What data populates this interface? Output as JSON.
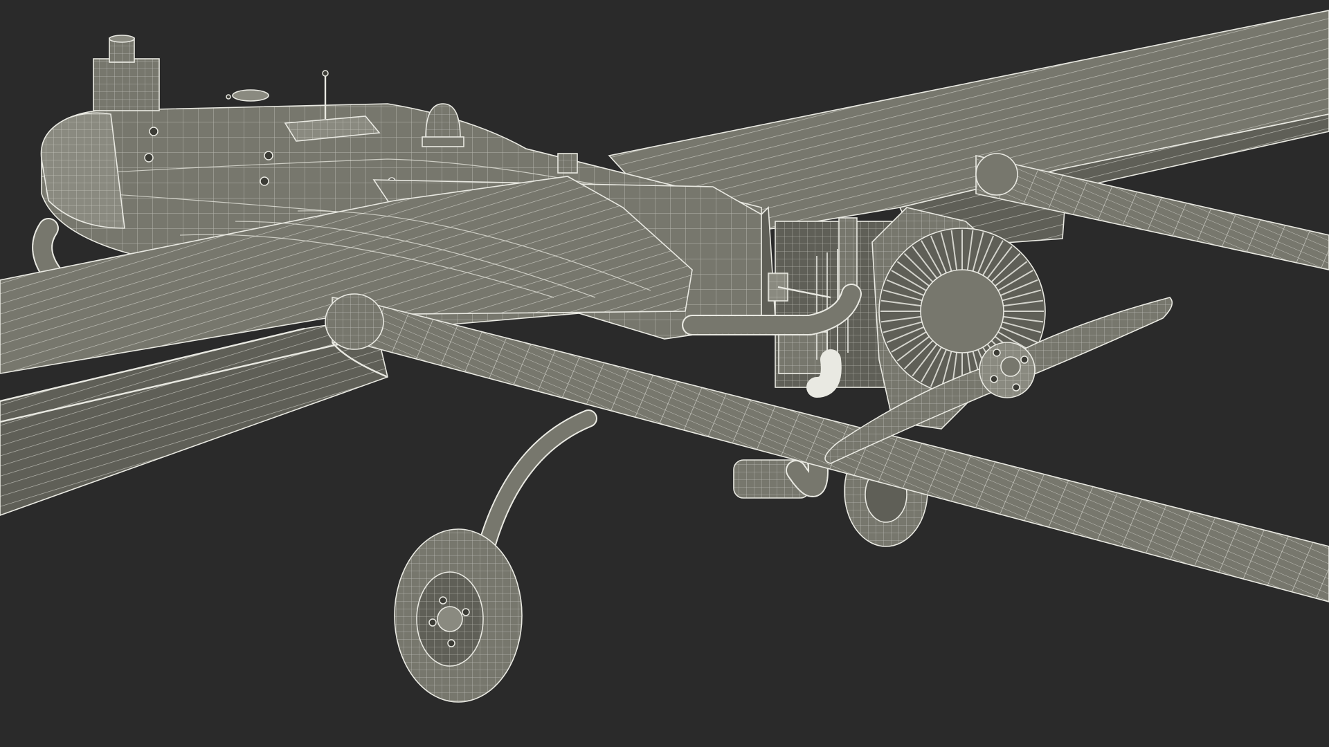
{
  "scene": {
    "background_color": "#2a2a2a",
    "surface_color": "#77776d",
    "surface_dark_color": "#5f5f57",
    "surface_light_color": "#8a8a80",
    "wire_color": "#e9e9e2",
    "shadow_color": "#3c3c36"
  }
}
